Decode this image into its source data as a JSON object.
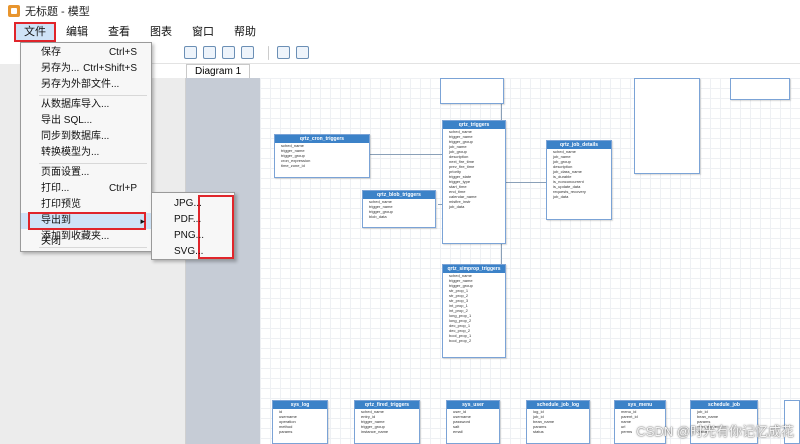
{
  "window": {
    "title": "无标题 - 模型"
  },
  "menubar": {
    "items": [
      "文件",
      "编辑",
      "查看",
      "图表",
      "窗口",
      "帮助"
    ]
  },
  "tab": {
    "label": "Diagram 1"
  },
  "file_menu": {
    "save": {
      "label": "保存",
      "shortcut": "Ctrl+S"
    },
    "save_as": {
      "label": "另存为...",
      "shortcut": "Ctrl+Shift+S"
    },
    "save_external": {
      "label": "另存为外部文件..."
    },
    "import_db": {
      "label": "从数据库导入..."
    },
    "export_sql": {
      "label": "导出 SQL..."
    },
    "sync_db": {
      "label": "同步到数据库..."
    },
    "convert": {
      "label": "转换模型为..."
    },
    "page_setup": {
      "label": "页面设置..."
    },
    "print": {
      "label": "打印...",
      "shortcut": "Ctrl+P"
    },
    "print_preview": {
      "label": "打印预览"
    },
    "export_to": {
      "label": "导出到"
    },
    "favorites": {
      "label": "添加到收藏夹..."
    },
    "close": {
      "label": "关闭"
    }
  },
  "export_submenu": {
    "items": [
      "JPG...",
      "PDF...",
      "PNG...",
      "SVG..."
    ]
  },
  "diagram": {
    "tables": [
      {
        "name": "qrtz_cron_triggers",
        "rows": [
          "sched_name",
          "trigger_name",
          "trigger_group",
          "cron_expression",
          "time_zone_id"
        ]
      },
      {
        "name": "qrtz_blob_triggers",
        "rows": [
          "sched_name",
          "trigger_name",
          "trigger_group",
          "blob_data"
        ]
      },
      {
        "name": "qrtz_triggers",
        "rows": [
          "sched_name",
          "trigger_name",
          "trigger_group",
          "job_name",
          "job_group",
          "description",
          "next_fire_time",
          "prev_fire_time",
          "priority",
          "trigger_state",
          "trigger_type",
          "start_time",
          "end_time",
          "calendar_name",
          "misfire_instr",
          "job_data"
        ]
      },
      {
        "name": "qrtz_job_details",
        "rows": [
          "sched_name",
          "job_name",
          "job_group",
          "description",
          "job_class_name",
          "is_durable",
          "is_nonconcurrent",
          "is_update_data",
          "requests_recovery",
          "job_data"
        ]
      },
      {
        "name": "qrtz_simprop_triggers",
        "rows": [
          "sched_name",
          "trigger_name",
          "trigger_group",
          "str_prop_1",
          "str_prop_2",
          "str_prop_3",
          "int_prop_1",
          "int_prop_2",
          "long_prop_1",
          "long_prop_2",
          "dec_prop_1",
          "dec_prop_2",
          "bool_prop_1",
          "bool_prop_2"
        ]
      },
      {
        "name": "sys_log",
        "rows": [
          "id",
          "username",
          "operation",
          "method",
          "params"
        ]
      },
      {
        "name": "qrtz_fired_triggers",
        "rows": [
          "sched_name",
          "entry_id",
          "trigger_name",
          "trigger_group",
          "instance_name"
        ]
      },
      {
        "name": "sys_user",
        "rows": [
          "user_id",
          "username",
          "password",
          "salt",
          "email"
        ]
      },
      {
        "name": "schedule_job_log",
        "rows": [
          "log_id",
          "job_id",
          "bean_name",
          "params",
          "status"
        ]
      },
      {
        "name": "sys_menu",
        "rows": [
          "menu_id",
          "parent_id",
          "name",
          "url",
          "perms"
        ]
      },
      {
        "name": "schedule_job",
        "rows": [
          "job_id",
          "bean_name",
          "params",
          "cron_expression",
          "status"
        ]
      }
    ]
  },
  "watermark": {
    "text": "CSDN @时光有你记忆成花"
  },
  "colors": {
    "accent": "#3c82c8",
    "highlight": "#e0252b",
    "menu_hover": "#cfe3f7"
  }
}
